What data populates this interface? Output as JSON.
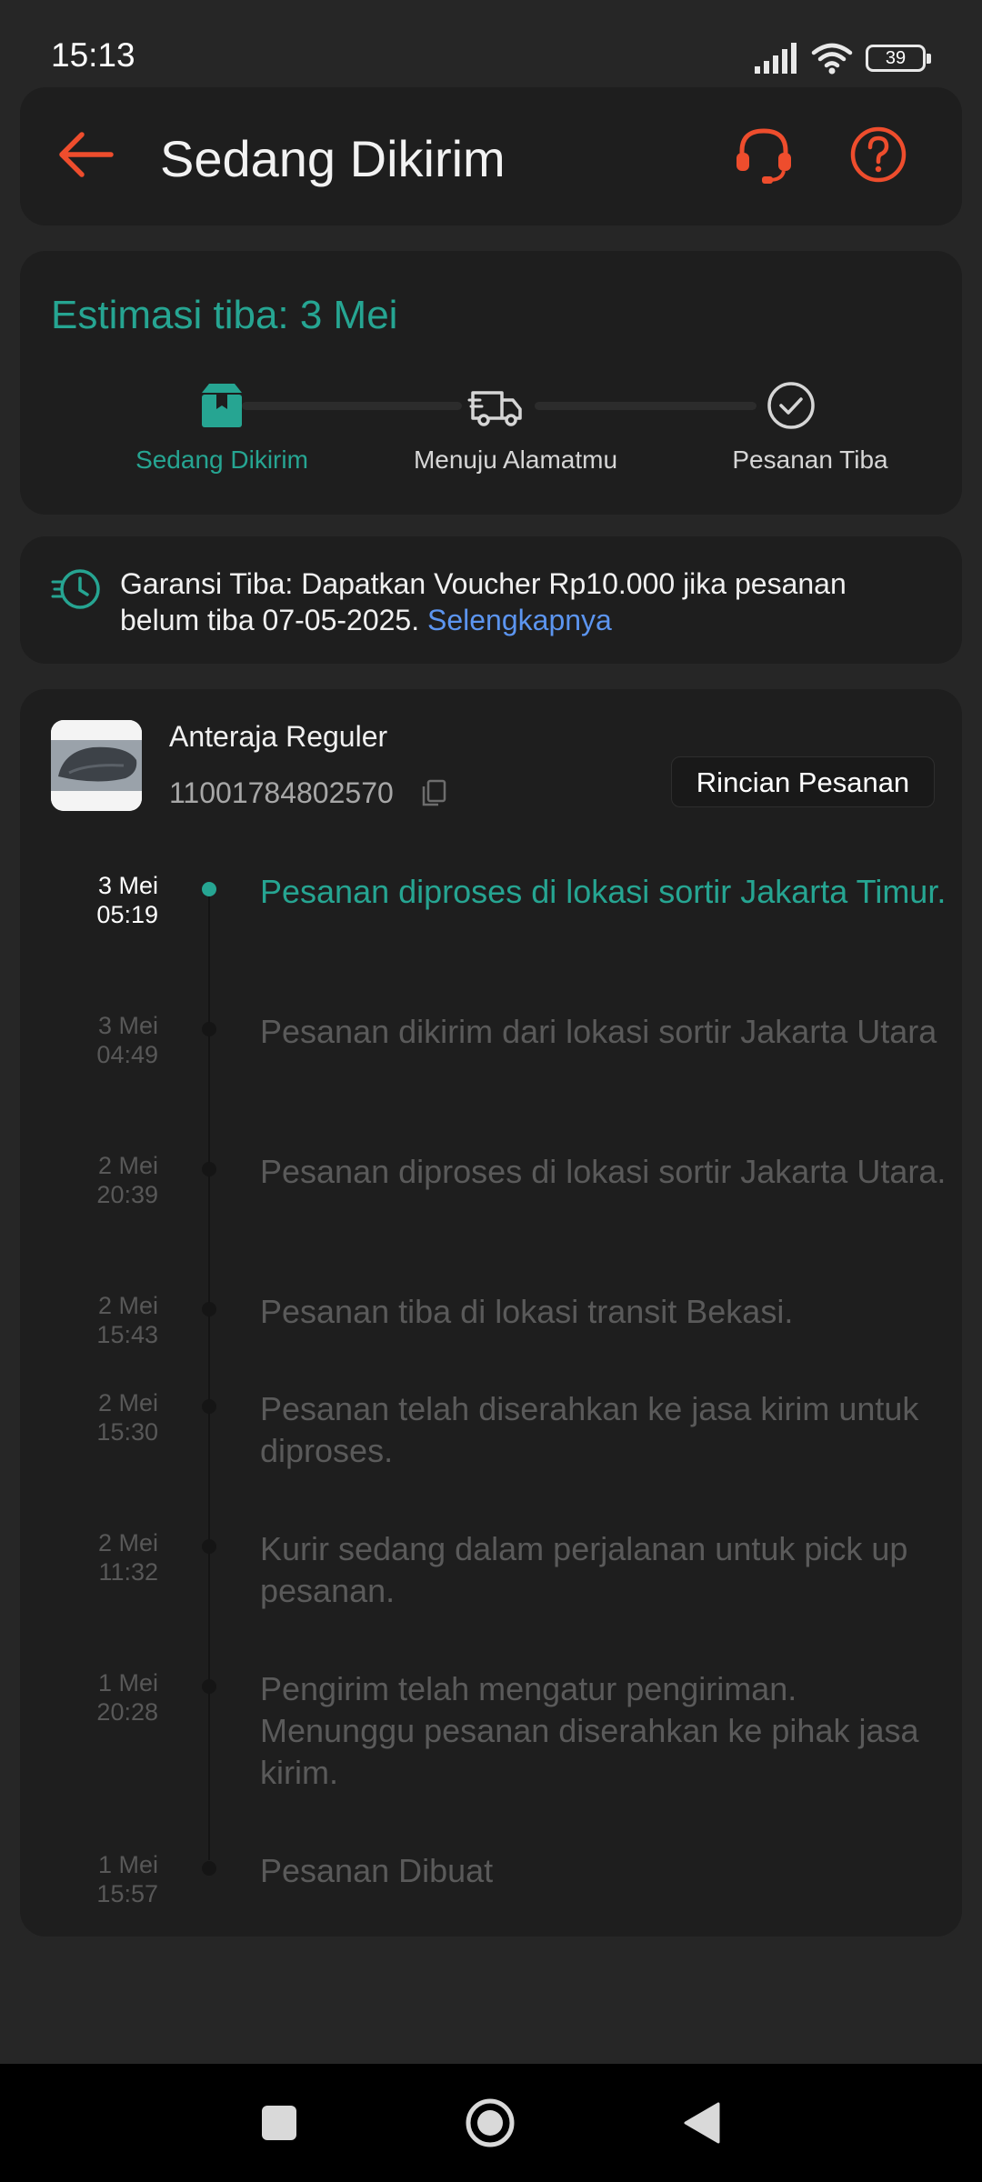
{
  "status": {
    "time": "15:13",
    "battery": "39"
  },
  "header": {
    "title": "Sedang Dikirim"
  },
  "estimate": {
    "title": "Estimasi tiba: 3 Mei",
    "steps": [
      {
        "label": "Sedang Dikirim",
        "icon": "box-icon",
        "active": true
      },
      {
        "label": "Menuju Alamatmu",
        "icon": "truck-icon",
        "active": false
      },
      {
        "label": "Pesanan Tiba",
        "icon": "check-circle-icon",
        "active": false
      }
    ]
  },
  "guarantee": {
    "text": "Garansi Tiba: Dapatkan Voucher Rp10.000 jika pesanan belum tiba 07-05-2025.",
    "link": "Selengkapnya"
  },
  "shipment": {
    "courier": "Anteraja Reguler",
    "tracking_number": "11001784802570",
    "detail_button": "Rincian Pesanan",
    "events": [
      {
        "date": "3 Mei",
        "time": "05:19",
        "text": "Pesanan diproses di lokasi sortir  Jakarta Timur.",
        "active": true
      },
      {
        "date": "3 Mei",
        "time": "04:49",
        "text": "Pesanan dikirim dari lokasi sortir  Jakarta Utara"
      },
      {
        "date": "2 Mei",
        "time": "20:39",
        "text": "Pesanan diproses di lokasi sortir  Jakarta Utara."
      },
      {
        "date": "2 Mei",
        "time": "15:43",
        "text": "Pesanan tiba di lokasi transit  Bekasi."
      },
      {
        "date": "2 Mei",
        "time": "15:30",
        "text": "Pesanan telah diserahkan ke jasa kirim untuk diproses."
      },
      {
        "date": "2 Mei",
        "time": "11:32",
        "text": "Kurir sedang dalam perjalanan untuk pick up pesanan."
      },
      {
        "date": "1 Mei",
        "time": "20:28",
        "text": "Pengirim telah mengatur pengiriman. Menunggu pesanan diserahkan ke pihak jasa kirim."
      },
      {
        "date": "1 Mei",
        "time": "15:57",
        "text": "Pesanan Dibuat"
      }
    ]
  },
  "colors": {
    "accent": "#26a592",
    "brand": "#ee4d2d",
    "link": "#5c95f0",
    "background": "#262626",
    "card": "#1e1e1e"
  }
}
